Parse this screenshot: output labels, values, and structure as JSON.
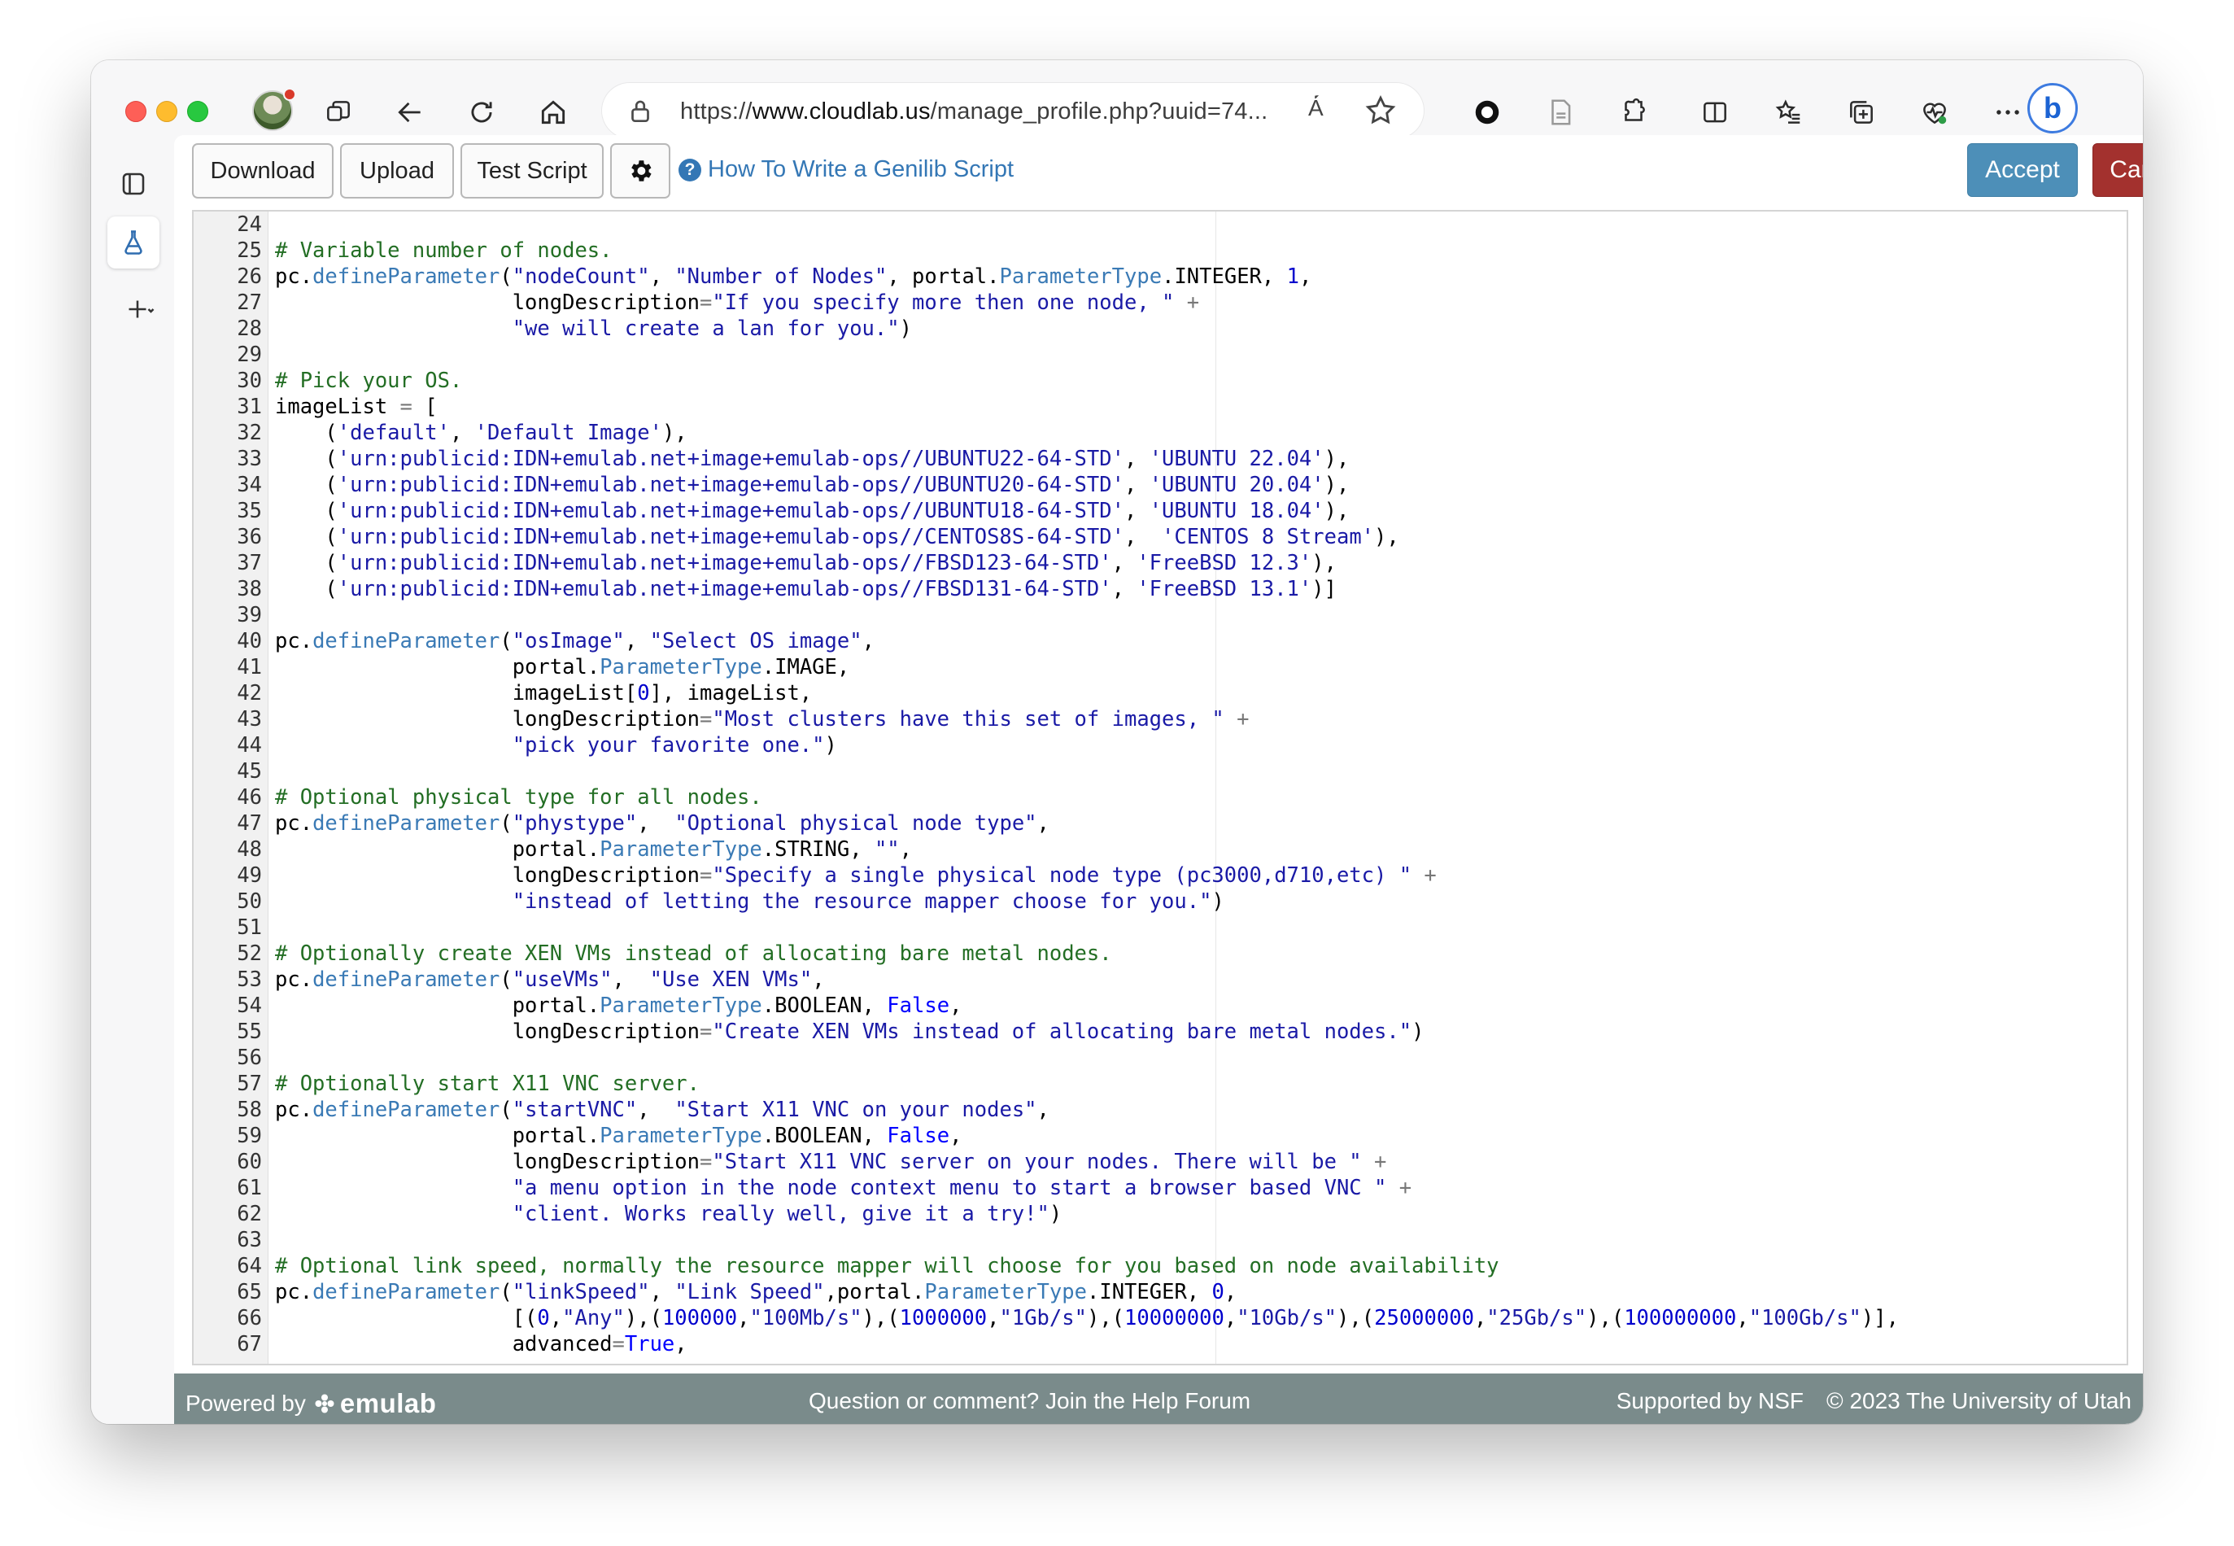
{
  "browser": {
    "url_prefix": "https://",
    "url_domain": "www.cloudlab.us",
    "url_path": "/manage_profile.php?uuid=74...",
    "read_aloud_label": "Ȧ́",
    "bing_label": "b"
  },
  "toolbar": {
    "download_label": "Download",
    "upload_label": "Upload",
    "test_script_label": "Test Script",
    "help_link_label": "How To Write a Genilib Script",
    "accept_label": "Accept",
    "cancel_label": "Cancel"
  },
  "editor": {
    "lines": [
      {
        "n": "24",
        "segs": []
      },
      {
        "n": "25",
        "segs": [
          [
            "cm",
            "# Variable number of nodes."
          ]
        ]
      },
      {
        "n": "26",
        "segs": [
          [
            "",
            "pc."
          ],
          [
            "sp",
            "defineParameter"
          ],
          [
            "",
            "("
          ],
          [
            "st",
            "\"nodeCount\""
          ],
          [
            "",
            ", "
          ],
          [
            "st",
            "\"Number of Nodes\""
          ],
          [
            "",
            ", portal."
          ],
          [
            "sp",
            "ParameterType"
          ],
          [
            "",
            ".INTEGER, "
          ],
          [
            "nm",
            "1"
          ],
          [
            "",
            ","
          ]
        ]
      },
      {
        "n": "27",
        "segs": [
          [
            "",
            "                   longDescription"
          ],
          [
            "op",
            "="
          ],
          [
            "st",
            "\"If you specify more then one node, \""
          ],
          [
            "op",
            " +"
          ]
        ]
      },
      {
        "n": "28",
        "segs": [
          [
            "st",
            "                   \"we will create a lan for you.\""
          ],
          [
            "",
            ")"
          ]
        ]
      },
      {
        "n": "29",
        "segs": []
      },
      {
        "n": "30",
        "segs": [
          [
            "cm",
            "# Pick your OS."
          ]
        ]
      },
      {
        "n": "31",
        "segs": [
          [
            "",
            "imageList "
          ],
          [
            "op",
            "="
          ],
          [
            "",
            " ["
          ]
        ]
      },
      {
        "n": "32",
        "segs": [
          [
            "",
            "    ("
          ],
          [
            "st",
            "'default'"
          ],
          [
            "",
            ", "
          ],
          [
            "st",
            "'Default Image'"
          ],
          [
            "",
            "),"
          ]
        ]
      },
      {
        "n": "33",
        "segs": [
          [
            "",
            "    ("
          ],
          [
            "st",
            "'urn:publicid:IDN+emulab.net+image+emulab-ops//UBUNTU22-64-STD'"
          ],
          [
            "",
            ", "
          ],
          [
            "st",
            "'UBUNTU 22.04'"
          ],
          [
            "",
            "),"
          ]
        ]
      },
      {
        "n": "34",
        "segs": [
          [
            "",
            "    ("
          ],
          [
            "st",
            "'urn:publicid:IDN+emulab.net+image+emulab-ops//UBUNTU20-64-STD'"
          ],
          [
            "",
            ", "
          ],
          [
            "st",
            "'UBUNTU 20.04'"
          ],
          [
            "",
            "),"
          ]
        ]
      },
      {
        "n": "35",
        "segs": [
          [
            "",
            "    ("
          ],
          [
            "st",
            "'urn:publicid:IDN+emulab.net+image+emulab-ops//UBUNTU18-64-STD'"
          ],
          [
            "",
            ", "
          ],
          [
            "st",
            "'UBUNTU 18.04'"
          ],
          [
            "",
            "),"
          ]
        ]
      },
      {
        "n": "36",
        "segs": [
          [
            "",
            "    ("
          ],
          [
            "st",
            "'urn:publicid:IDN+emulab.net+image+emulab-ops//CENTOS8S-64-STD'"
          ],
          [
            "",
            ",  "
          ],
          [
            "st",
            "'CENTOS 8 Stream'"
          ],
          [
            "",
            "),"
          ]
        ]
      },
      {
        "n": "37",
        "segs": [
          [
            "",
            "    ("
          ],
          [
            "st",
            "'urn:publicid:IDN+emulab.net+image+emulab-ops//FBSD123-64-STD'"
          ],
          [
            "",
            ", "
          ],
          [
            "st",
            "'FreeBSD 12.3'"
          ],
          [
            "",
            "),"
          ]
        ]
      },
      {
        "n": "38",
        "segs": [
          [
            "",
            "    ("
          ],
          [
            "st",
            "'urn:publicid:IDN+emulab.net+image+emulab-ops//FBSD131-64-STD'"
          ],
          [
            "",
            ", "
          ],
          [
            "st",
            "'FreeBSD 13.1'"
          ],
          [
            "",
            ")]"
          ]
        ]
      },
      {
        "n": "39",
        "segs": []
      },
      {
        "n": "40",
        "segs": [
          [
            "",
            "pc."
          ],
          [
            "sp",
            "defineParameter"
          ],
          [
            "",
            "("
          ],
          [
            "st",
            "\"osImage\""
          ],
          [
            "",
            ", "
          ],
          [
            "st",
            "\"Select OS image\""
          ],
          [
            "",
            ","
          ]
        ]
      },
      {
        "n": "41",
        "segs": [
          [
            "",
            "                   portal."
          ],
          [
            "sp",
            "ParameterType"
          ],
          [
            "",
            ".IMAGE,"
          ]
        ]
      },
      {
        "n": "42",
        "segs": [
          [
            "",
            "                   imageList["
          ],
          [
            "nm",
            "0"
          ],
          [
            "",
            "], imageList,"
          ]
        ]
      },
      {
        "n": "43",
        "segs": [
          [
            "",
            "                   longDescription"
          ],
          [
            "op",
            "="
          ],
          [
            "st",
            "\"Most clusters have this set of images, \""
          ],
          [
            "op",
            " +"
          ]
        ]
      },
      {
        "n": "44",
        "segs": [
          [
            "st",
            "                   \"pick your favorite one.\""
          ],
          [
            "",
            ")"
          ]
        ]
      },
      {
        "n": "45",
        "segs": []
      },
      {
        "n": "46",
        "segs": [
          [
            "cm",
            "# Optional physical type for all nodes."
          ]
        ]
      },
      {
        "n": "47",
        "segs": [
          [
            "",
            "pc."
          ],
          [
            "sp",
            "defineParameter"
          ],
          [
            "",
            "("
          ],
          [
            "st",
            "\"phystype\""
          ],
          [
            "",
            ",  "
          ],
          [
            "st",
            "\"Optional physical node type\""
          ],
          [
            "",
            ","
          ]
        ]
      },
      {
        "n": "48",
        "segs": [
          [
            "",
            "                   portal."
          ],
          [
            "sp",
            "ParameterType"
          ],
          [
            "",
            ".STRING, "
          ],
          [
            "st",
            "\"\""
          ],
          [
            "",
            ","
          ]
        ]
      },
      {
        "n": "49",
        "segs": [
          [
            "",
            "                   longDescription"
          ],
          [
            "op",
            "="
          ],
          [
            "st",
            "\"Specify a single physical node type (pc3000,d710,etc) \""
          ],
          [
            "op",
            " +"
          ]
        ]
      },
      {
        "n": "50",
        "segs": [
          [
            "st",
            "                   \"instead of letting the resource mapper choose for you.\""
          ],
          [
            "",
            ")"
          ]
        ]
      },
      {
        "n": "51",
        "segs": []
      },
      {
        "n": "52",
        "segs": [
          [
            "cm",
            "# Optionally create XEN VMs instead of allocating bare metal nodes."
          ]
        ]
      },
      {
        "n": "53",
        "segs": [
          [
            "",
            "pc."
          ],
          [
            "sp",
            "defineParameter"
          ],
          [
            "",
            "("
          ],
          [
            "st",
            "\"useVMs\""
          ],
          [
            "",
            ",  "
          ],
          [
            "st",
            "\"Use XEN VMs\""
          ],
          [
            "",
            ","
          ]
        ]
      },
      {
        "n": "54",
        "segs": [
          [
            "",
            "                   portal."
          ],
          [
            "sp",
            "ParameterType"
          ],
          [
            "",
            ".BOOLEAN, "
          ],
          [
            "kw",
            "False"
          ],
          [
            "",
            ","
          ]
        ]
      },
      {
        "n": "55",
        "segs": [
          [
            "",
            "                   longDescription"
          ],
          [
            "op",
            "="
          ],
          [
            "st",
            "\"Create XEN VMs instead of allocating bare metal nodes.\""
          ],
          [
            "",
            ")"
          ]
        ]
      },
      {
        "n": "56",
        "segs": []
      },
      {
        "n": "57",
        "segs": [
          [
            "cm",
            "# Optionally start X11 VNC server."
          ]
        ]
      },
      {
        "n": "58",
        "segs": [
          [
            "",
            "pc."
          ],
          [
            "sp",
            "defineParameter"
          ],
          [
            "",
            "("
          ],
          [
            "st",
            "\"startVNC\""
          ],
          [
            "",
            ",  "
          ],
          [
            "st",
            "\"Start X11 VNC on your nodes\""
          ],
          [
            "",
            ","
          ]
        ]
      },
      {
        "n": "59",
        "segs": [
          [
            "",
            "                   portal."
          ],
          [
            "sp",
            "ParameterType"
          ],
          [
            "",
            ".BOOLEAN, "
          ],
          [
            "kw",
            "False"
          ],
          [
            "",
            ","
          ]
        ]
      },
      {
        "n": "60",
        "segs": [
          [
            "",
            "                   longDescription"
          ],
          [
            "op",
            "="
          ],
          [
            "st",
            "\"Start X11 VNC server on your nodes. There will be \""
          ],
          [
            "op",
            " +"
          ]
        ]
      },
      {
        "n": "61",
        "segs": [
          [
            "st",
            "                   \"a menu option in the node context menu to start a browser based VNC \""
          ],
          [
            "op",
            " +"
          ]
        ]
      },
      {
        "n": "62",
        "segs": [
          [
            "st",
            "                   \"client. Works really well, give it a try!\""
          ],
          [
            "",
            ")"
          ]
        ]
      },
      {
        "n": "63",
        "segs": []
      },
      {
        "n": "64",
        "segs": [
          [
            "cm",
            "# Optional link speed, normally the resource mapper will choose for you based on node availability"
          ]
        ]
      },
      {
        "n": "65",
        "segs": [
          [
            "",
            "pc."
          ],
          [
            "sp",
            "defineParameter"
          ],
          [
            "",
            "("
          ],
          [
            "st",
            "\"linkSpeed\""
          ],
          [
            "",
            ", "
          ],
          [
            "st",
            "\"Link Speed\""
          ],
          [
            "",
            ",portal."
          ],
          [
            "sp",
            "ParameterType"
          ],
          [
            "",
            ".INTEGER, "
          ],
          [
            "nm",
            "0"
          ],
          [
            "",
            ","
          ]
        ]
      },
      {
        "n": "66",
        "segs": [
          [
            "",
            "                   [("
          ],
          [
            "nm",
            "0"
          ],
          [
            "",
            ","
          ],
          [
            "st",
            "\"Any\""
          ],
          [
            "",
            "),("
          ],
          [
            "nm",
            "100000"
          ],
          [
            "",
            ","
          ],
          [
            "st",
            "\"100Mb/s\""
          ],
          [
            "",
            "),("
          ],
          [
            "nm",
            "1000000"
          ],
          [
            "",
            ","
          ],
          [
            "st",
            "\"1Gb/s\""
          ],
          [
            "",
            "),("
          ],
          [
            "nm",
            "10000000"
          ],
          [
            "",
            ","
          ],
          [
            "st",
            "\"10Gb/s\""
          ],
          [
            "",
            "),("
          ],
          [
            "nm",
            "25000000"
          ],
          [
            "",
            ","
          ],
          [
            "st",
            "\"25Gb/s\""
          ],
          [
            "",
            "),("
          ],
          [
            "nm",
            "100000000"
          ],
          [
            "",
            ","
          ],
          [
            "st",
            "\"100Gb/s\""
          ],
          [
            "",
            ")],"
          ]
        ]
      },
      {
        "n": "67",
        "segs": [
          [
            "",
            "                   advanced"
          ],
          [
            "op",
            "="
          ],
          [
            "kw",
            "True"
          ],
          [
            "",
            ","
          ]
        ]
      }
    ]
  },
  "footer": {
    "powered_by": "Powered by",
    "logo_text": "emulab",
    "help_forum": "Question or comment? Join the Help Forum",
    "supported_by": "Supported by NSF",
    "copyright": "© 2023 The University of Utah"
  }
}
